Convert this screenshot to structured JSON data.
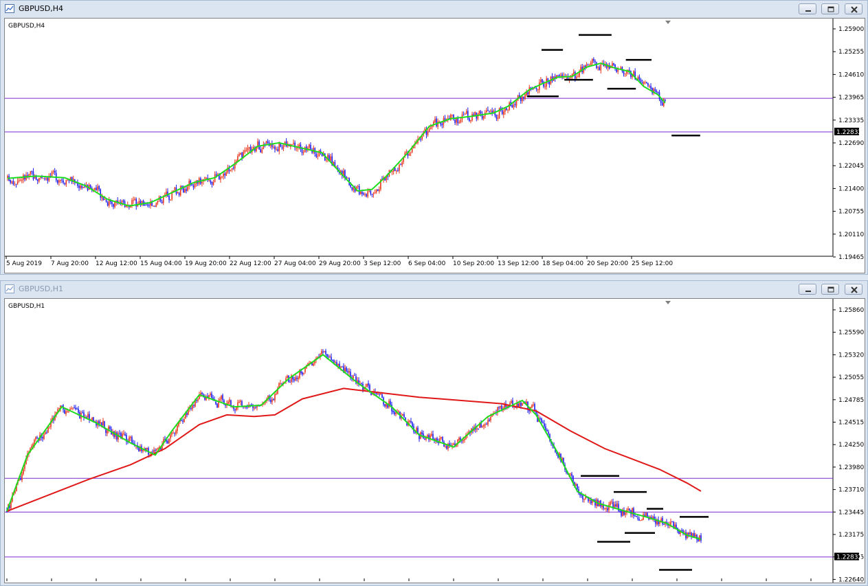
{
  "window1": {
    "title": "GBPUSD,H4"
  },
  "window2": {
    "title": "GBPUSD,H1"
  },
  "colors": {
    "bull": "#e8351a",
    "bear": "#1a1af0",
    "ma_fast": "#1edc1e",
    "ma_slow": "#e01818",
    "level": "#7a2ad0",
    "marker": "#000000"
  },
  "chart_data": [
    {
      "type": "candlestick",
      "symbol_label": "GBPUSD,H4",
      "price_axis": {
        "ticks": [
          "1.25900",
          "1.25255",
          "1.24610",
          "1.23965",
          "1.23335",
          "1.22690",
          "1.22045",
          "1.21400",
          "1.20755",
          "1.20110",
          "1.19465"
        ],
        "range": [
          1.1925,
          1.2612
        ]
      },
      "time_axis": {
        "labels": [
          "5 Aug 2019",
          "7 Aug 20:00",
          "12 Aug 12:00",
          "15 Aug 04:00",
          "19 Aug 20:00",
          "22 Aug 12:00",
          "27 Aug 04:00",
          "29 Aug 20:00",
          "3 Sep 12:00",
          "6 Sep 04:00",
          "10 Sep 20:00",
          "13 Sep 12:00",
          "18 Sep 04:00",
          "20 Sep 20:00",
          "25 Sep 12:00"
        ]
      },
      "current_price": "1.22832",
      "horizontal_levels": [
        1.2384,
        1.2283
      ],
      "moving_average_path": [
        [
          0,
          1.2143
        ],
        [
          20,
          1.215
        ],
        [
          40,
          1.2145
        ],
        [
          55,
          1.212
        ],
        [
          70,
          1.208
        ],
        [
          85,
          1.206
        ],
        [
          100,
          1.207
        ],
        [
          115,
          1.21
        ],
        [
          130,
          1.213
        ],
        [
          145,
          1.2145
        ],
        [
          160,
          1.219
        ],
        [
          175,
          1.224
        ],
        [
          190,
          1.225
        ],
        [
          205,
          1.2235
        ],
        [
          220,
          1.222
        ],
        [
          235,
          1.215
        ],
        [
          245,
          1.2105
        ],
        [
          255,
          1.211
        ],
        [
          265,
          1.215
        ],
        [
          280,
          1.222
        ],
        [
          295,
          1.23
        ],
        [
          310,
          1.2323
        ],
        [
          325,
          1.233
        ],
        [
          340,
          1.234
        ],
        [
          350,
          1.236
        ],
        [
          365,
          1.241
        ],
        [
          375,
          1.243
        ],
        [
          385,
          1.2448
        ],
        [
          395,
          1.245
        ],
        [
          405,
          1.2478
        ],
        [
          415,
          1.249
        ],
        [
          425,
          1.2475
        ],
        [
          435,
          1.2465
        ],
        [
          445,
          1.242
        ],
        [
          455,
          1.2395
        ],
        [
          460,
          1.237
        ]
      ],
      "support_resistance_markers": [
        [
          374,
          389,
          1.253
        ],
        [
          364,
          386,
          1.239
        ],
        [
          390,
          410,
          1.244
        ],
        [
          400,
          423,
          1.2575
        ],
        [
          420,
          440,
          1.2413
        ],
        [
          433,
          451,
          1.25
        ],
        [
          465,
          485,
          1.2272
        ]
      ]
    },
    {
      "type": "candlestick",
      "symbol_label": "GBPUSD,H1",
      "price_axis": {
        "ticks": [
          "1.25860",
          "1.25590",
          "1.25320",
          "1.25055",
          "1.24785",
          "1.24515",
          "1.24250",
          "1.23980",
          "1.23710",
          "1.23445",
          "1.23175",
          "1.22905",
          "1.22640"
        ],
        "range": [
          1.2258,
          1.2596
        ]
      },
      "current_price": "1.22832",
      "horizontal_levels": [
        1.2381,
        1.2339,
        1.2283
      ],
      "moving_average_path": [
        [
          0,
          1.234
        ],
        [
          15,
          1.241
        ],
        [
          40,
          1.247
        ],
        [
          65,
          1.245
        ],
        [
          90,
          1.2425
        ],
        [
          108,
          1.241
        ],
        [
          120,
          1.244
        ],
        [
          140,
          1.2485
        ],
        [
          165,
          1.247
        ],
        [
          185,
          1.2472
        ],
        [
          205,
          1.2505
        ],
        [
          230,
          1.2535
        ],
        [
          255,
          1.25
        ],
        [
          280,
          1.247
        ],
        [
          300,
          1.2435
        ],
        [
          325,
          1.242
        ],
        [
          350,
          1.2458
        ],
        [
          375,
          1.2478
        ],
        [
          385,
          1.246
        ],
        [
          400,
          1.2415
        ],
        [
          415,
          1.2365
        ],
        [
          430,
          1.235
        ],
        [
          450,
          1.234
        ],
        [
          465,
          1.2333
        ],
        [
          480,
          1.2325
        ],
        [
          495,
          1.231
        ],
        [
          505,
          1.2305
        ]
      ],
      "moving_average_slow_path": [
        [
          0,
          1.234
        ],
        [
          30,
          1.236
        ],
        [
          60,
          1.238
        ],
        [
          90,
          1.2398
        ],
        [
          115,
          1.2418
        ],
        [
          140,
          1.2448
        ],
        [
          160,
          1.246
        ],
        [
          180,
          1.2458
        ],
        [
          195,
          1.246
        ],
        [
          215,
          1.248
        ],
        [
          245,
          1.2493
        ],
        [
          270,
          1.2488
        ],
        [
          300,
          1.2482
        ],
        [
          330,
          1.2478
        ],
        [
          360,
          1.2474
        ],
        [
          385,
          1.2465
        ],
        [
          410,
          1.244
        ],
        [
          435,
          1.2418
        ],
        [
          455,
          1.2405
        ],
        [
          475,
          1.2392
        ],
        [
          495,
          1.2375
        ],
        [
          505,
          1.2365
        ]
      ],
      "support_resistance_markers": [
        [
          418,
          446,
          1.2384
        ],
        [
          442,
          466,
          1.2364
        ],
        [
          430,
          454,
          1.2302
        ],
        [
          466,
          478,
          1.2343
        ],
        [
          450,
          472,
          1.2313
        ],
        [
          490,
          511,
          1.2333
        ],
        [
          475,
          499,
          1.2267
        ]
      ]
    }
  ]
}
